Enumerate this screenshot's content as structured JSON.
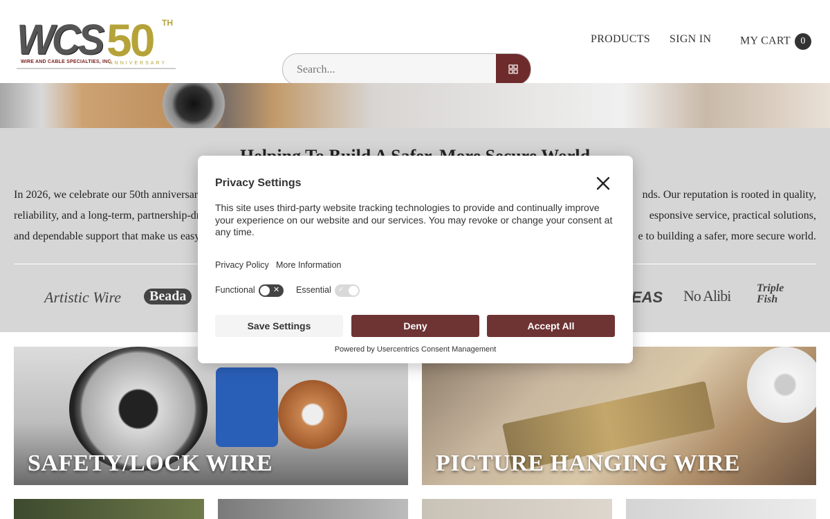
{
  "header": {
    "logo": {
      "main": "WCS",
      "fifty": "50",
      "suffix": "TH",
      "company": "WIRE AND CABLE SPECIALTIES, INC.",
      "anniversary": "ANNIVERSARY"
    },
    "nav": {
      "products": "PRODUCTS",
      "sign_in": "SIGN IN",
      "cart": "MY CART",
      "cart_count": "0"
    },
    "search": {
      "placeholder": "Search...",
      "button_icon": "grid-search-icon"
    }
  },
  "band": {
    "heading": "Helping To Build A Safer, More Secure World",
    "paragraph": "In 2026, we celebrate our 50th anniversary ... nds. Our reputation is rooted in quality, reliability, and a long-term, partnership-dr ... esponsive service, practical solutions, and dependable support that make us easy ... e to building a safer, more secure world.",
    "lines": [
      {
        "left": "In 2026, we celebrate our 50th anniversar",
        "right": "nds. Our reputation is rooted in quality,"
      },
      {
        "left": "reliability, and a long-term, partnership-dr",
        "right": "esponsive service, practical solutions,"
      },
      {
        "left": "and dependable support that make us easy",
        "right": "e to building a safer, more secure world."
      }
    ],
    "brands": [
      "Artistic Wire",
      "Beada",
      "EAS",
      "No Alibi",
      "Triple Fish"
    ]
  },
  "tiles": [
    {
      "title": "SAFETY/LOCK WIRE"
    },
    {
      "title": "PICTURE HANGING WIRE"
    },
    {
      "title": ""
    },
    {
      "title": ""
    },
    {
      "title": ""
    },
    {
      "title": ""
    }
  ],
  "modal": {
    "title": "Privacy Settings",
    "description": "This site uses third-party website tracking technologies to provide and continually improve your experience on our website and our services. You may revoke or change your consent at any time.",
    "links": {
      "privacy_policy": "Privacy Policy",
      "more_info": "More Information"
    },
    "toggles": {
      "functional": "Functional",
      "essential": "Essential"
    },
    "buttons": {
      "save": "Save Settings",
      "deny": "Deny",
      "accept": "Accept All"
    },
    "powered_by": "Powered by Usercentrics Consent Management"
  },
  "colors": {
    "brand_maroon": "#6e3333",
    "logo_gold": "#b5a33a",
    "band_gray": "#d6d6d6"
  }
}
